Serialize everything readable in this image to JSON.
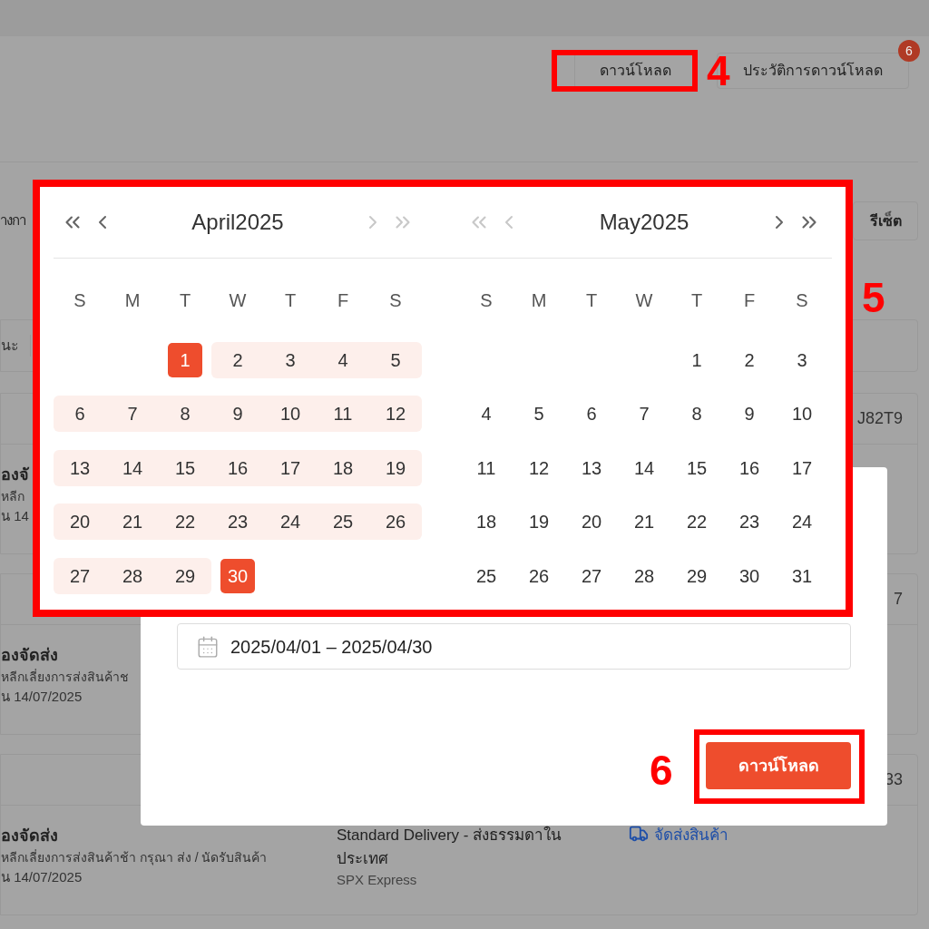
{
  "page": {
    "toolbar_buttons": [
      {
        "label": "ดาวน์โหลด"
      },
      {
        "label": "ประวัติการดาวน์โหลด",
        "badge": "6"
      }
    ],
    "filter_tab": "างกา",
    "reset_button": "รีเซ็ต",
    "status_filter": "นะ",
    "orders": [
      {
        "header": "J82T9",
        "status": "องจั",
        "note": "หลีก",
        "date": "น 14"
      },
      {
        "header": "7",
        "status": "องจัดส่ง",
        "note": "หลีกเลี่ยงการส่งสินค้าช",
        "date": "น 14/07/2025"
      },
      {
        "header": "33",
        "status": "องจัดส่ง",
        "note": "หลีกเลี่ยงการส่งสินค้าช้า กรุณา ส่ง / นัดรับสินค้า",
        "date": "น 14/07/2025",
        "shipping": "Standard Delivery - ส่งธรรมดาใน ประเทศ",
        "carrier": "SPX Express",
        "action": "จัดส่งสินค้า"
      }
    ]
  },
  "dialog": {
    "date_range": "2025/04/01 – 2025/04/30",
    "download_button": "ดาวน์โหลด"
  },
  "date_picker": {
    "months": [
      {
        "title": "April2025",
        "prev_enabled": true,
        "next_enabled": false,
        "weekdays": [
          "S",
          "M",
          "T",
          "W",
          "T",
          "F",
          "S"
        ],
        "weeks": [
          [
            {
              "kind": "blank"
            },
            {
              "kind": "blank"
            },
            {
              "kind": "day",
              "label": "1",
              "selected": true,
              "in_range": false
            },
            {
              "kind": "day",
              "label": "2",
              "selected": false,
              "in_range": true
            },
            {
              "kind": "day",
              "label": "3",
              "selected": false,
              "in_range": true
            },
            {
              "kind": "day",
              "label": "4",
              "selected": false,
              "in_range": true
            },
            {
              "kind": "day",
              "label": "5",
              "selected": false,
              "in_range": true
            }
          ],
          [
            {
              "kind": "day",
              "label": "6",
              "selected": false,
              "in_range": true
            },
            {
              "kind": "day",
              "label": "7",
              "selected": false,
              "in_range": true
            },
            {
              "kind": "day",
              "label": "8",
              "selected": false,
              "in_range": true
            },
            {
              "kind": "day",
              "label": "9",
              "selected": false,
              "in_range": true
            },
            {
              "kind": "day",
              "label": "10",
              "selected": false,
              "in_range": true
            },
            {
              "kind": "day",
              "label": "11",
              "selected": false,
              "in_range": true
            },
            {
              "kind": "day",
              "label": "12",
              "selected": false,
              "in_range": true
            }
          ],
          [
            {
              "kind": "day",
              "label": "13",
              "selected": false,
              "in_range": true
            },
            {
              "kind": "day",
              "label": "14",
              "selected": false,
              "in_range": true
            },
            {
              "kind": "day",
              "label": "15",
              "selected": false,
              "in_range": true
            },
            {
              "kind": "day",
              "label": "16",
              "selected": false,
              "in_range": true
            },
            {
              "kind": "day",
              "label": "17",
              "selected": false,
              "in_range": true
            },
            {
              "kind": "day",
              "label": "18",
              "selected": false,
              "in_range": true
            },
            {
              "kind": "day",
              "label": "19",
              "selected": false,
              "in_range": true
            }
          ],
          [
            {
              "kind": "day",
              "label": "20",
              "selected": false,
              "in_range": true
            },
            {
              "kind": "day",
              "label": "21",
              "selected": false,
              "in_range": true
            },
            {
              "kind": "day",
              "label": "22",
              "selected": false,
              "in_range": true
            },
            {
              "kind": "day",
              "label": "23",
              "selected": false,
              "in_range": true
            },
            {
              "kind": "day",
              "label": "24",
              "selected": false,
              "in_range": true
            },
            {
              "kind": "day",
              "label": "25",
              "selected": false,
              "in_range": true
            },
            {
              "kind": "day",
              "label": "26",
              "selected": false,
              "in_range": true
            }
          ],
          [
            {
              "kind": "day",
              "label": "27",
              "selected": false,
              "in_range": true
            },
            {
              "kind": "day",
              "label": "28",
              "selected": false,
              "in_range": true
            },
            {
              "kind": "day",
              "label": "29",
              "selected": false,
              "in_range": true
            },
            {
              "kind": "day",
              "label": "30",
              "selected": true,
              "in_range": false
            },
            {
              "kind": "blank"
            },
            {
              "kind": "blank"
            },
            {
              "kind": "blank"
            }
          ]
        ]
      },
      {
        "title": "May2025",
        "prev_enabled": false,
        "next_enabled": true,
        "weekdays": [
          "S",
          "M",
          "T",
          "W",
          "T",
          "F",
          "S"
        ],
        "weeks": [
          [
            {
              "kind": "blank"
            },
            {
              "kind": "blank"
            },
            {
              "kind": "blank"
            },
            {
              "kind": "blank"
            },
            {
              "kind": "day",
              "label": "1",
              "selected": false,
              "in_range": false
            },
            {
              "kind": "day",
              "label": "2",
              "selected": false,
              "in_range": false
            },
            {
              "kind": "day",
              "label": "3",
              "selected": false,
              "in_range": false
            }
          ],
          [
            {
              "kind": "day",
              "label": "4",
              "selected": false,
              "in_range": false
            },
            {
              "kind": "day",
              "label": "5",
              "selected": false,
              "in_range": false
            },
            {
              "kind": "day",
              "label": "6",
              "selected": false,
              "in_range": false
            },
            {
              "kind": "day",
              "label": "7",
              "selected": false,
              "in_range": false
            },
            {
              "kind": "day",
              "label": "8",
              "selected": false,
              "in_range": false
            },
            {
              "kind": "day",
              "label": "9",
              "selected": false,
              "in_range": false
            },
            {
              "kind": "day",
              "label": "10",
              "selected": false,
              "in_range": false
            }
          ],
          [
            {
              "kind": "day",
              "label": "11",
              "selected": false,
              "in_range": false
            },
            {
              "kind": "day",
              "label": "12",
              "selected": false,
              "in_range": false
            },
            {
              "kind": "day",
              "label": "13",
              "selected": false,
              "in_range": false
            },
            {
              "kind": "day",
              "label": "14",
              "selected": false,
              "in_range": false
            },
            {
              "kind": "day",
              "label": "15",
              "selected": false,
              "in_range": false
            },
            {
              "kind": "day",
              "label": "16",
              "selected": false,
              "in_range": false
            },
            {
              "kind": "day",
              "label": "17",
              "selected": false,
              "in_range": false
            }
          ],
          [
            {
              "kind": "day",
              "label": "18",
              "selected": false,
              "in_range": false
            },
            {
              "kind": "day",
              "label": "19",
              "selected": false,
              "in_range": false
            },
            {
              "kind": "day",
              "label": "20",
              "selected": false,
              "in_range": false
            },
            {
              "kind": "day",
              "label": "21",
              "selected": false,
              "in_range": false
            },
            {
              "kind": "day",
              "label": "22",
              "selected": false,
              "in_range": false
            },
            {
              "kind": "day",
              "label": "23",
              "selected": false,
              "in_range": false
            },
            {
              "kind": "day",
              "label": "24",
              "selected": false,
              "in_range": false
            }
          ],
          [
            {
              "kind": "day",
              "label": "25",
              "selected": false,
              "in_range": false
            },
            {
              "kind": "day",
              "label": "26",
              "selected": false,
              "in_range": false
            },
            {
              "kind": "day",
              "label": "27",
              "selected": false,
              "in_range": false
            },
            {
              "kind": "day",
              "label": "28",
              "selected": false,
              "in_range": false
            },
            {
              "kind": "day",
              "label": "29",
              "selected": false,
              "in_range": false
            },
            {
              "kind": "day",
              "label": "30",
              "selected": false,
              "in_range": false
            },
            {
              "kind": "day",
              "label": "31",
              "selected": false,
              "in_range": false
            }
          ]
        ]
      }
    ]
  },
  "annotations": [
    {
      "label": "4"
    },
    {
      "label": "5"
    },
    {
      "label": "6"
    }
  ]
}
